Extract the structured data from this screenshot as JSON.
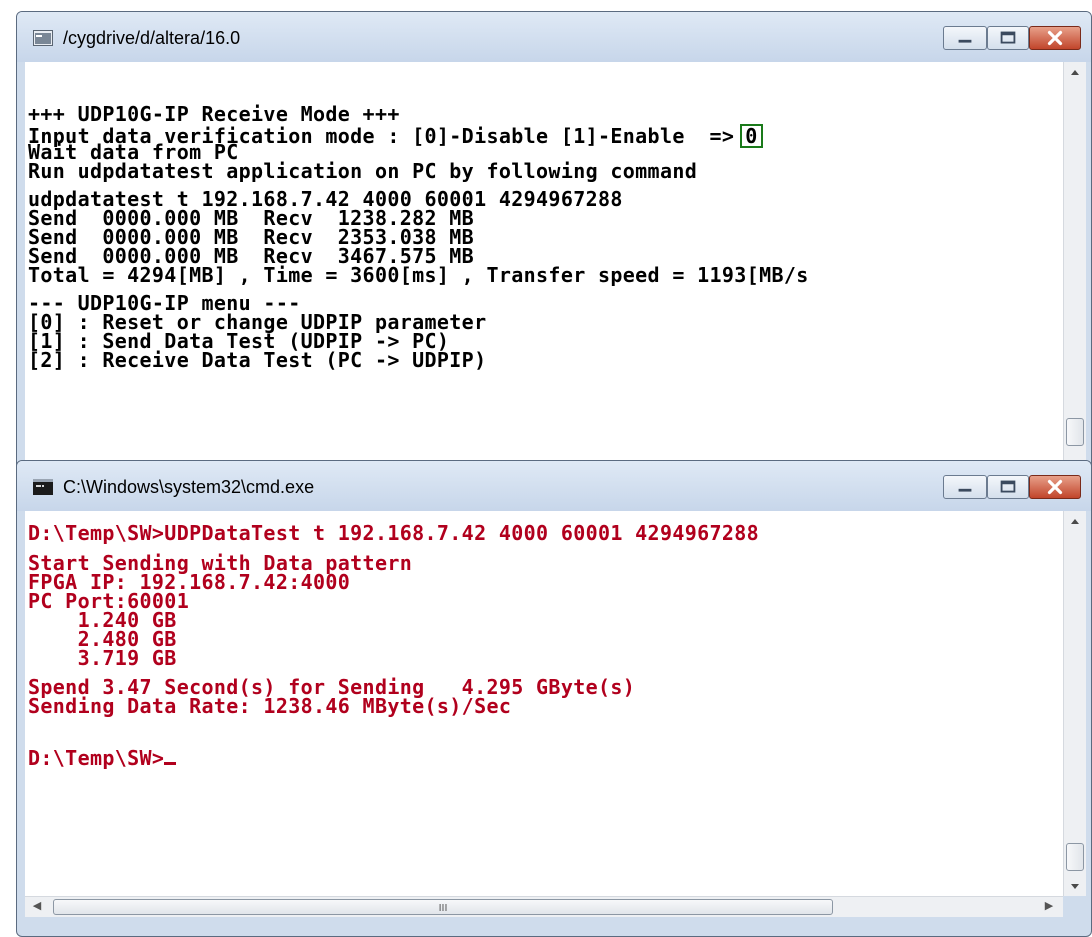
{
  "colors": {
    "cygwin_text": "#000000",
    "cmd_text": "#b1001d",
    "highlight_box": "#1a7a1a"
  },
  "cygwin": {
    "title": "/cygdrive/d/altera/16.0",
    "icon": "terminal-icon",
    "lines": [
      "+++ UDP10G-IP Receive Mode +++",
      "Input data verification mode : [0]-Disable [1]-Enable  =>",
      "Wait data from PC",
      "Run udpdatatest application on PC by following command",
      "udpdatatest t 192.168.7.42 4000 60001 4294967288",
      "Send  0000.000 MB  Recv  1238.282 MB",
      "Send  0000.000 MB  Recv  2353.038 MB",
      "Send  0000.000 MB  Recv  3467.575 MB",
      "Total = 4294[MB] , Time = 3600[ms] , Transfer speed = 1193[MB/s",
      "--- UDP10G-IP menu ---",
      "[0] : Reset or change UDPIP parameter",
      "[1] : Send Data Test (UDPIP -> PC)",
      "[2] : Receive Data Test (PC -> UDPIP)"
    ],
    "input_value": "0"
  },
  "cmd": {
    "title": "C:\\Windows\\system32\\cmd.exe",
    "icon": "cmd-icon",
    "lines": [
      "D:\\Temp\\SW>UDPDataTest t 192.168.7.42 4000 60001 4294967288",
      "Start Sending with Data pattern",
      "FPGA IP: 192.168.7.42:4000",
      "PC Port:60001",
      "    1.240 GB",
      "    2.480 GB",
      "    3.719 GB",
      "Spend 3.47 Second(s) for Sending   4.295 GByte(s)",
      "Sending Data Rate: 1238.46 MByte(s)/Sec",
      "D:\\Temp\\SW>"
    ]
  },
  "scrollbar": {
    "grip": "III"
  }
}
